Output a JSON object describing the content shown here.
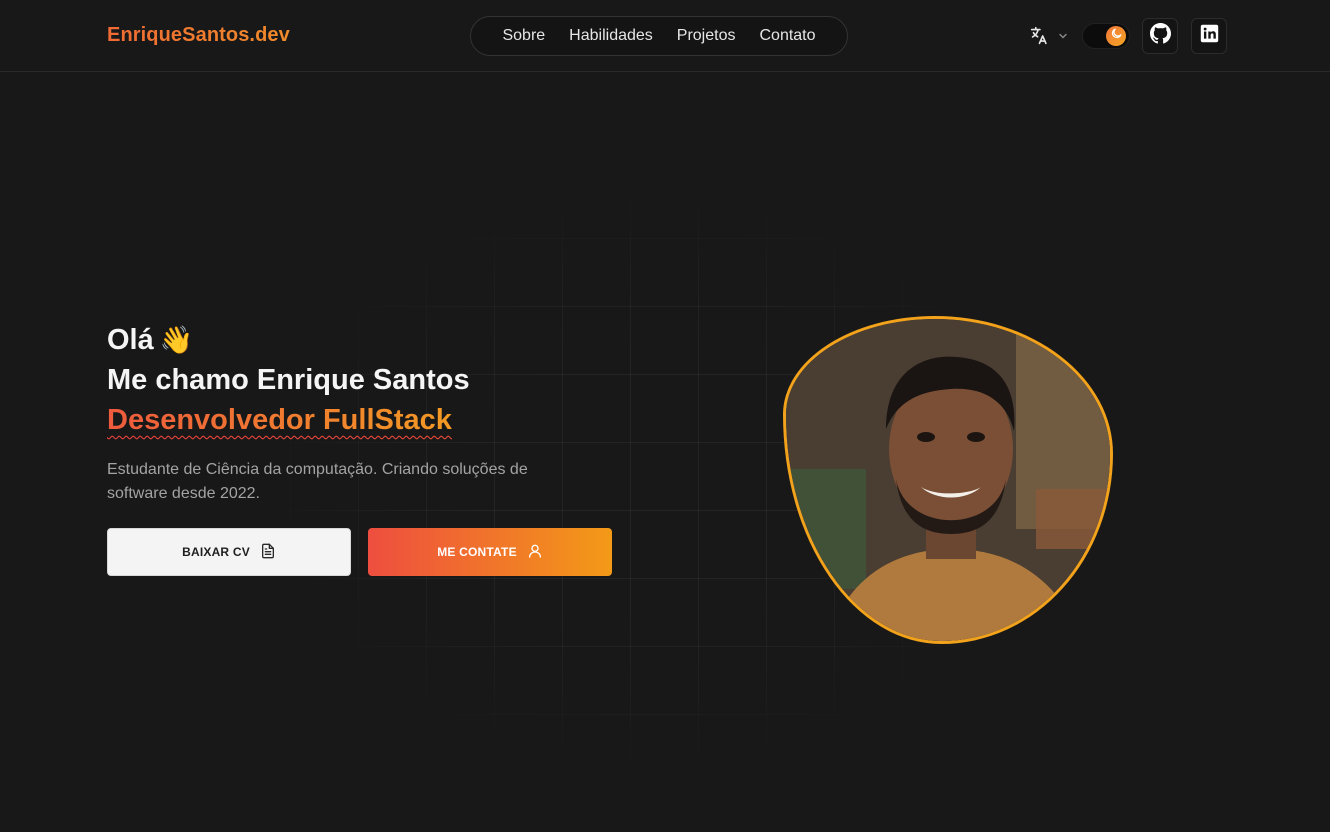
{
  "header": {
    "logo": "EnriqueSantos.dev",
    "nav": [
      {
        "label": "Sobre"
      },
      {
        "label": "Habilidades"
      },
      {
        "label": "Projetos"
      },
      {
        "label": "Contato"
      }
    ],
    "icons": [
      "translate-icon",
      "chevron-down-icon",
      "moon-icon",
      "github-icon",
      "linkedin-icon"
    ]
  },
  "hero": {
    "greeting": "Olá",
    "wave_emoji": "👋",
    "intro": "Me chamo Enrique Santos",
    "role": "Desenvolvedor FullStack",
    "subtitle": "Estudante de Ciência da computação. Criando soluções de software desde 2022.",
    "cv_button": "BAIXAR CV",
    "contact_button": "ME CONTATE"
  },
  "colors": {
    "background": "#181818",
    "accent_start": "#ee4e3f",
    "accent_end": "#f39a17",
    "photo_border": "#f2a21b"
  }
}
